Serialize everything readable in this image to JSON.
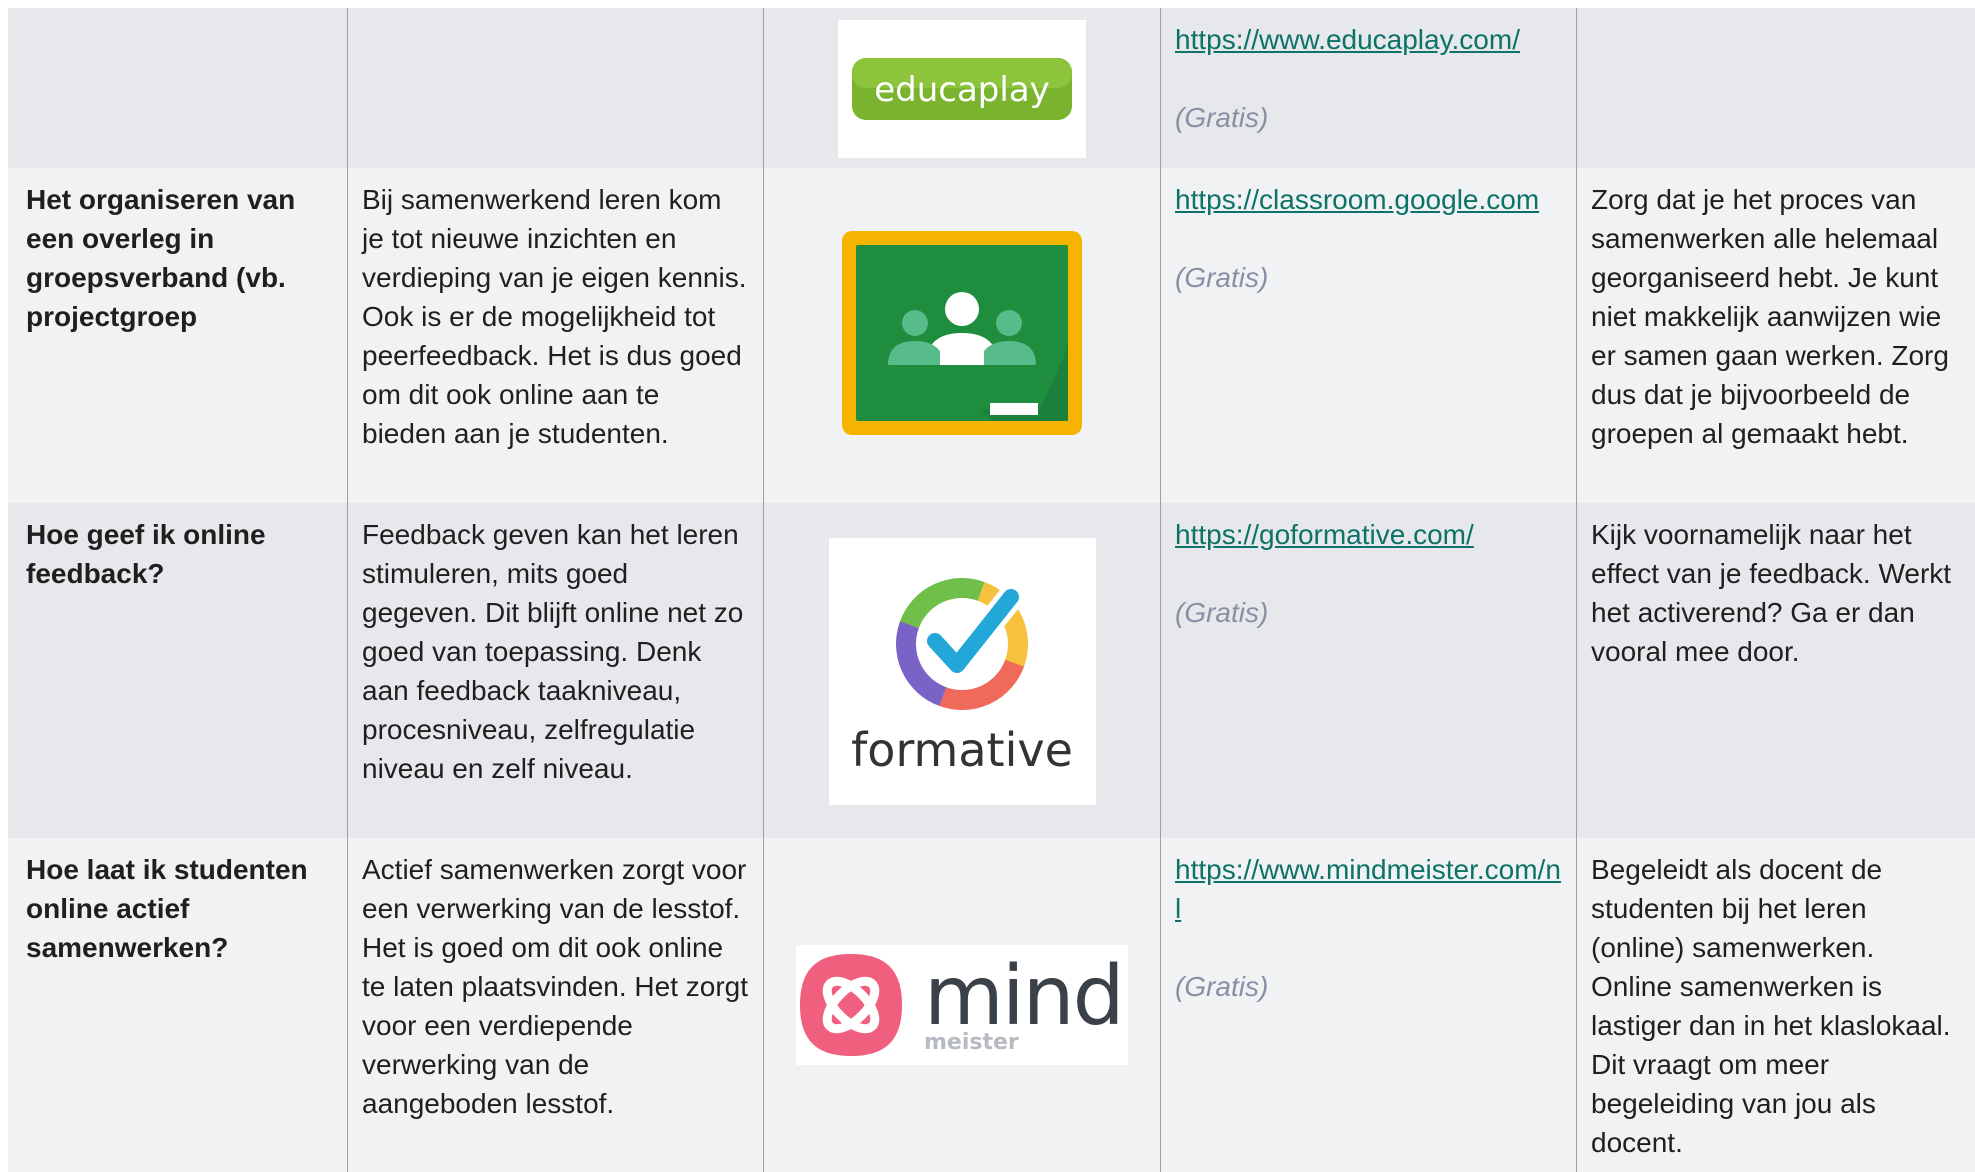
{
  "rows": [
    {
      "question": "",
      "description": "",
      "logo": {
        "name": "educaplay-logo",
        "text": "educaplay"
      },
      "url": "https://www.educaplay.com/",
      "price": "(Gratis)",
      "tip": ""
    },
    {
      "question": "Het organiseren van een overleg in groepsverband (vb. projectgroep",
      "description": "Bij samenwerkend leren kom je tot nieuwe inzichten en verdieping van je eigen kennis. Ook is er de mogelijkheid tot peerfeedback. Het is dus goed om dit ook online aan te bieden aan je studenten.",
      "logo": {
        "name": "google-classroom-logo",
        "text": ""
      },
      "url": "https://classroom.google.com",
      "price": "(Gratis)",
      "tip": "Zorg dat je het proces van samenwerken alle helemaal georganiseerd hebt. Je kunt niet makkelijk aanwijzen wie er samen gaan werken. Zorg dus dat je bijvoorbeeld de groepen al gemaakt hebt."
    },
    {
      "question": "Hoe geef ik online feedback?",
      "description": "Feedback geven kan het leren stimuleren, mits goed gegeven. Dit blijft online net zo goed van toepassing. Denk aan feedback taakniveau, procesniveau, zelfregulatie niveau en zelf niveau.",
      "logo": {
        "name": "formative-logo",
        "text": "formative"
      },
      "url": "https://goformative.com/",
      "price": "(Gratis)",
      "tip": "Kijk voornamelijk naar het effect van je feedback. Werkt het activerend? Ga er dan vooral mee door."
    },
    {
      "question": "Hoe laat ik studenten online actief samenwerken?",
      "description": "Actief samenwerken zorgt voor een verwerking van de lesstof. Het is goed om dit ook online te laten plaatsvinden. Het zorgt voor een verdiepende verwerking van de aangeboden lesstof.",
      "logo": {
        "name": "mindmeister-logo",
        "text": "mind",
        "subtext": "meister"
      },
      "url": "https://www.mindmeister.com/nl",
      "price": "(Gratis)",
      "tip": "Begeleidt als docent de studenten bij het leren (online) samenwerken. Online samenwerken is lastiger dan in het klaslokaal. Dit vraagt om meer begeleiding van jou als docent."
    }
  ],
  "colors": {
    "shaded_row": "#e7e8ec",
    "light_row": "#f1f2f4",
    "link": "#0d7267",
    "price": "#8a8fa6",
    "educaplay_green": "#7ab32e",
    "classroom_green": "#1e8e3e",
    "classroom_yellow": "#f4b400",
    "mindmeister_pink": "#f0607e",
    "mindmeister_gray": "#3a4149"
  }
}
